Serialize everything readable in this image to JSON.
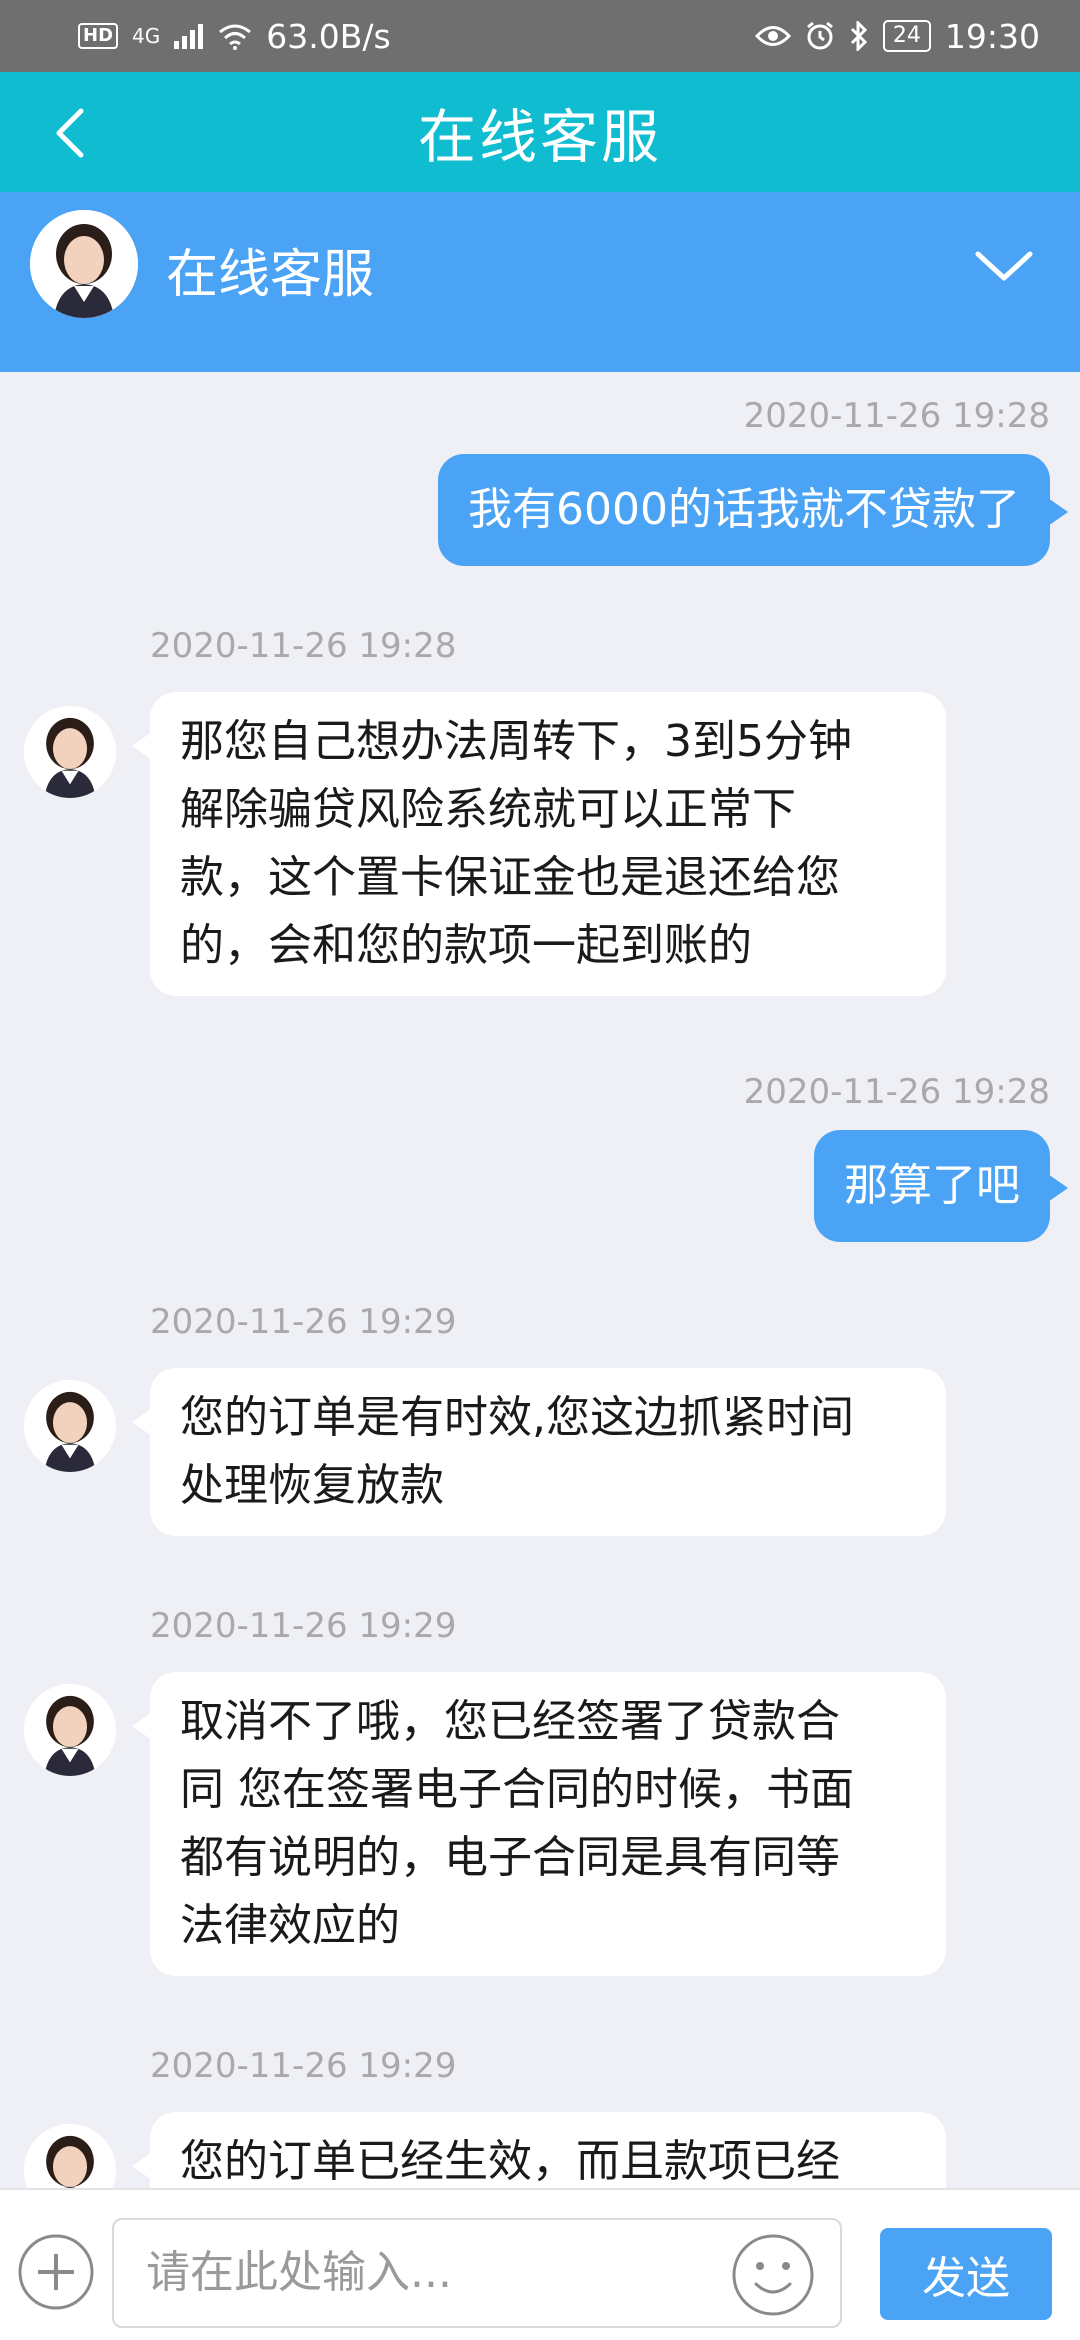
{
  "status_bar": {
    "hd_badge": "HD",
    "signal": "4G",
    "net_speed": "63.0B/s",
    "battery": "24",
    "time": "19:30",
    "icons": [
      "eye-icon",
      "alarm-icon",
      "bluetooth-icon"
    ]
  },
  "header": {
    "title": "在线客服"
  },
  "agent": {
    "name": "在线客服"
  },
  "messages": [
    {
      "side": "out",
      "time": "2020-11-26 19:28",
      "text": "我有6000的话我就不贷款了"
    },
    {
      "side": "in",
      "time": "2020-11-26 19:28",
      "lines": [
        "那您自己想办法周转下，3到5分钟",
        "解除骗贷风险系统就可以正常下",
        "款，这个置卡保证金也是退还给您",
        "的，会和您的款项一起到账的"
      ]
    },
    {
      "side": "out",
      "time": "2020-11-26 19:28",
      "text": "那算了吧"
    },
    {
      "side": "in",
      "time": "2020-11-26 19:29",
      "lines": [
        "您的订单是有时效,您这边抓紧时间",
        "处理恢复放款"
      ]
    },
    {
      "side": "in",
      "time": "2020-11-26 19:29",
      "lines": [
        "取消不了哦，您已经签署了贷款合",
        "同 您在签署电子合同的时候，书面",
        "都有说明的，电子合同是具有同等",
        "法律效应的"
      ]
    },
    {
      "side": "in",
      "time": "2020-11-26 19:29",
      "lines": [
        "您的订单已经生效，而且款项已经"
      ]
    }
  ],
  "input": {
    "placeholder": "请在此处输入...",
    "send_label": "发送"
  },
  "colors": {
    "status_bar": "#6f6f6f",
    "title_bar": "#10bcd0",
    "accent": "#4aa3f5",
    "chat_bg": "#eef0f5"
  }
}
